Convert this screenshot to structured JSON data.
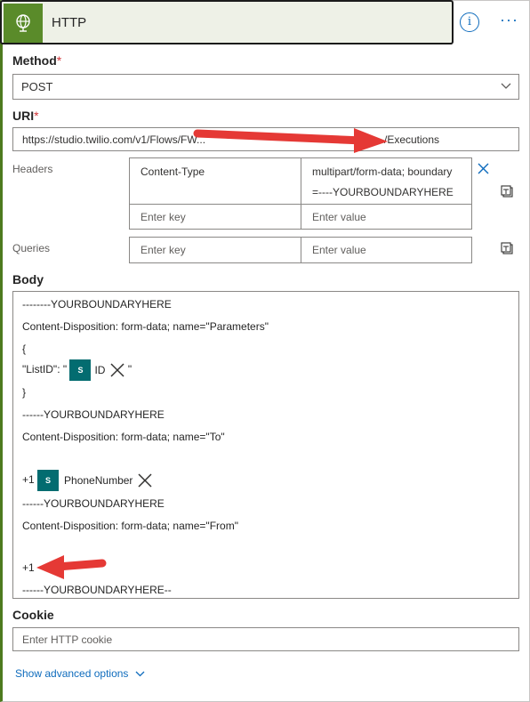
{
  "header": {
    "title": "HTTP",
    "info_icon": "info-icon",
    "more_icon": "ellipsis-icon"
  },
  "method": {
    "label": "Method",
    "required_mark": "*",
    "value": "POST"
  },
  "uri": {
    "label": "URI",
    "required_mark": "*",
    "value": "https://studio.twilio.com/v1/Flows/FW...",
    "value_end": "/Executions"
  },
  "headers": {
    "label": "Headers",
    "rows": [
      {
        "key": "Content-Type",
        "value_line1": "multipart/form-data; boundary",
        "value_line2": "=----YOURBOUNDARYHERE"
      }
    ],
    "key_placeholder": "Enter key",
    "value_placeholder": "Enter value"
  },
  "queries": {
    "label": "Queries",
    "key_placeholder": "Enter key",
    "value_placeholder": "Enter value"
  },
  "body": {
    "label": "Body",
    "line1": "--------YOURBOUNDARYHERE",
    "line2": "Content-Disposition: form-data; name=\"Parameters\"",
    "line3": "{",
    "line4_prefix": "\"ListID\": \"",
    "line4_token": "ID",
    "line4_suffix": "\"",
    "line5": "}",
    "line6": "------YOURBOUNDARYHERE",
    "line7": "Content-Disposition: form-data; name=\"To\"",
    "line8_prefix": "+1",
    "line8_token": "PhoneNumber",
    "line9": "------YOURBOUNDARYHERE",
    "line10": "Content-Disposition: form-data; name=\"From\"",
    "line11": "+1",
    "line12": "------YOURBOUNDARYHERE--",
    "token_icon_text": "S"
  },
  "cookie": {
    "label": "Cookie",
    "placeholder": "Enter HTTP cookie"
  },
  "advanced": {
    "label": "Show advanced options"
  },
  "colors": {
    "accent": "#0f6cbd",
    "header_bg": "#eef1e7",
    "icon_bg": "#5a8b2a",
    "token_bg": "#036c70",
    "arrow": "#e53935"
  }
}
